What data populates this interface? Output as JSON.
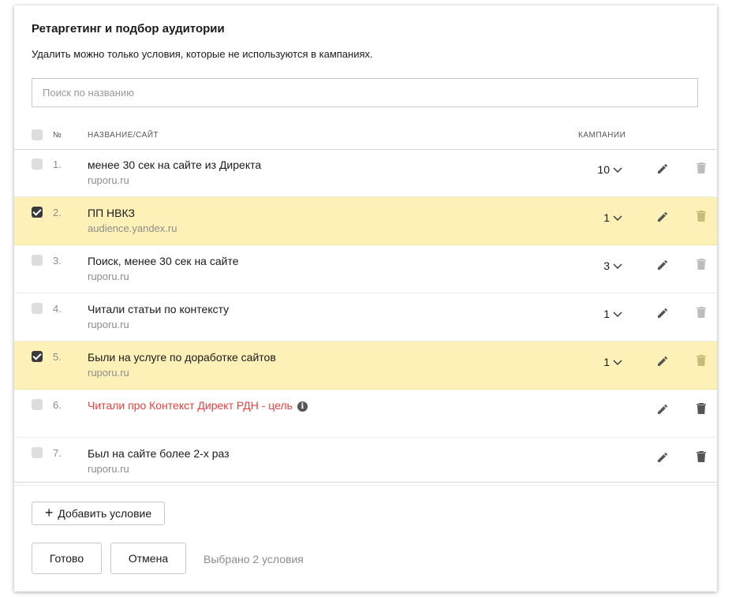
{
  "title": "Ретаргетинг и подбор аудитории",
  "subtitle": "Удалить можно только условия, которые не используются в кампаниях.",
  "search": {
    "placeholder": "Поиск по названию",
    "value": ""
  },
  "table": {
    "headers": {
      "num": "№",
      "name": "Название/сайт",
      "campaigns": "Кампании"
    },
    "rows": [
      {
        "num": "1.",
        "name": "менее 30 сек на сайте из Директа",
        "site": "ruporu.ru",
        "campaigns": "10",
        "checked": false,
        "deletable": false,
        "error": false
      },
      {
        "num": "2.",
        "name": "ПП НВКЗ",
        "site": "audience.yandex.ru",
        "campaigns": "1",
        "checked": true,
        "deletable": false,
        "error": false
      },
      {
        "num": "3.",
        "name": "Поиск, менее 30 сек на сайте",
        "site": "ruporu.ru",
        "campaigns": "3",
        "checked": false,
        "deletable": false,
        "error": false
      },
      {
        "num": "4.",
        "name": "Читали статьи по контексту",
        "site": "ruporu.ru",
        "campaigns": "1",
        "checked": false,
        "deletable": false,
        "error": false
      },
      {
        "num": "5.",
        "name": "Были на услуге по доработке сайтов",
        "site": "ruporu.ru",
        "campaigns": "1",
        "checked": true,
        "deletable": false,
        "error": false
      },
      {
        "num": "6.",
        "name": "Читали про Контекст Директ РДН - цель",
        "site": "",
        "campaigns": "",
        "checked": false,
        "deletable": true,
        "error": true
      },
      {
        "num": "7.",
        "name": "Был на сайте более 2-х раз",
        "site": "ruporu.ru",
        "campaigns": "",
        "checked": false,
        "deletable": true,
        "error": false
      }
    ]
  },
  "icons": {
    "edit": "pencil-icon",
    "delete": "trash-icon",
    "info": "info-icon",
    "expand": "chevron-down-icon"
  },
  "colors": {
    "selected_row": "#fdf1b8",
    "error_text": "#e5413e",
    "icon_active": "#555555",
    "icon_disabled": "#bdbdbd"
  },
  "buttons": {
    "add": "Добавить условие",
    "done": "Готово",
    "cancel": "Отмена"
  },
  "footer": {
    "selected_text": "Выбрано 2 условия"
  }
}
